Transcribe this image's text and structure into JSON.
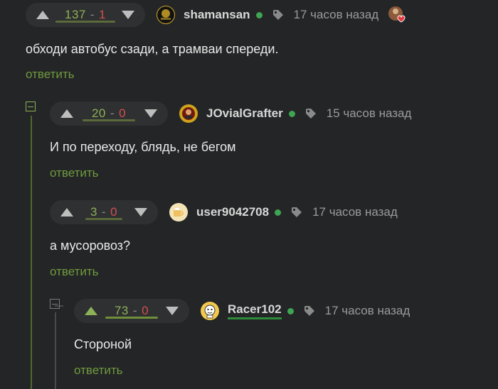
{
  "comments": [
    {
      "votes": {
        "up": "137",
        "sep": "-",
        "down": "1"
      },
      "username": "shamansan",
      "time": "17 часов назад",
      "text": "обходи автобус сзади, а трамваи спереди.",
      "reply_label": "ответить",
      "avatar_icon": "shamansan-avatar"
    },
    {
      "votes": {
        "up": "20",
        "sep": "-",
        "down": "0"
      },
      "username": "JOvialGrafter",
      "time": "15 часов назад",
      "text": "И по переходу, блядь, не бегом",
      "reply_label": "ответить",
      "avatar_icon": "jovialgrafter-avatar"
    },
    {
      "votes": {
        "up": "3",
        "sep": "-",
        "down": "0"
      },
      "username": "user9042708",
      "time": "17 часов назад",
      "text": "а мусоровоз?",
      "reply_label": "ответить",
      "avatar_icon": "user9042708-avatar"
    },
    {
      "votes": {
        "up": "73",
        "sep": "-",
        "down": "0"
      },
      "username": "Racer102",
      "time": "17 часов назад",
      "text": "Стороной",
      "reply_label": "ответить",
      "avatar_icon": "racer102-avatar"
    }
  ],
  "colors": {
    "background": "#242526",
    "upvote_green": "#8cb156",
    "downvote_red": "#d05050",
    "reply_green": "#6f9a3e",
    "online_green": "#3fa454"
  }
}
